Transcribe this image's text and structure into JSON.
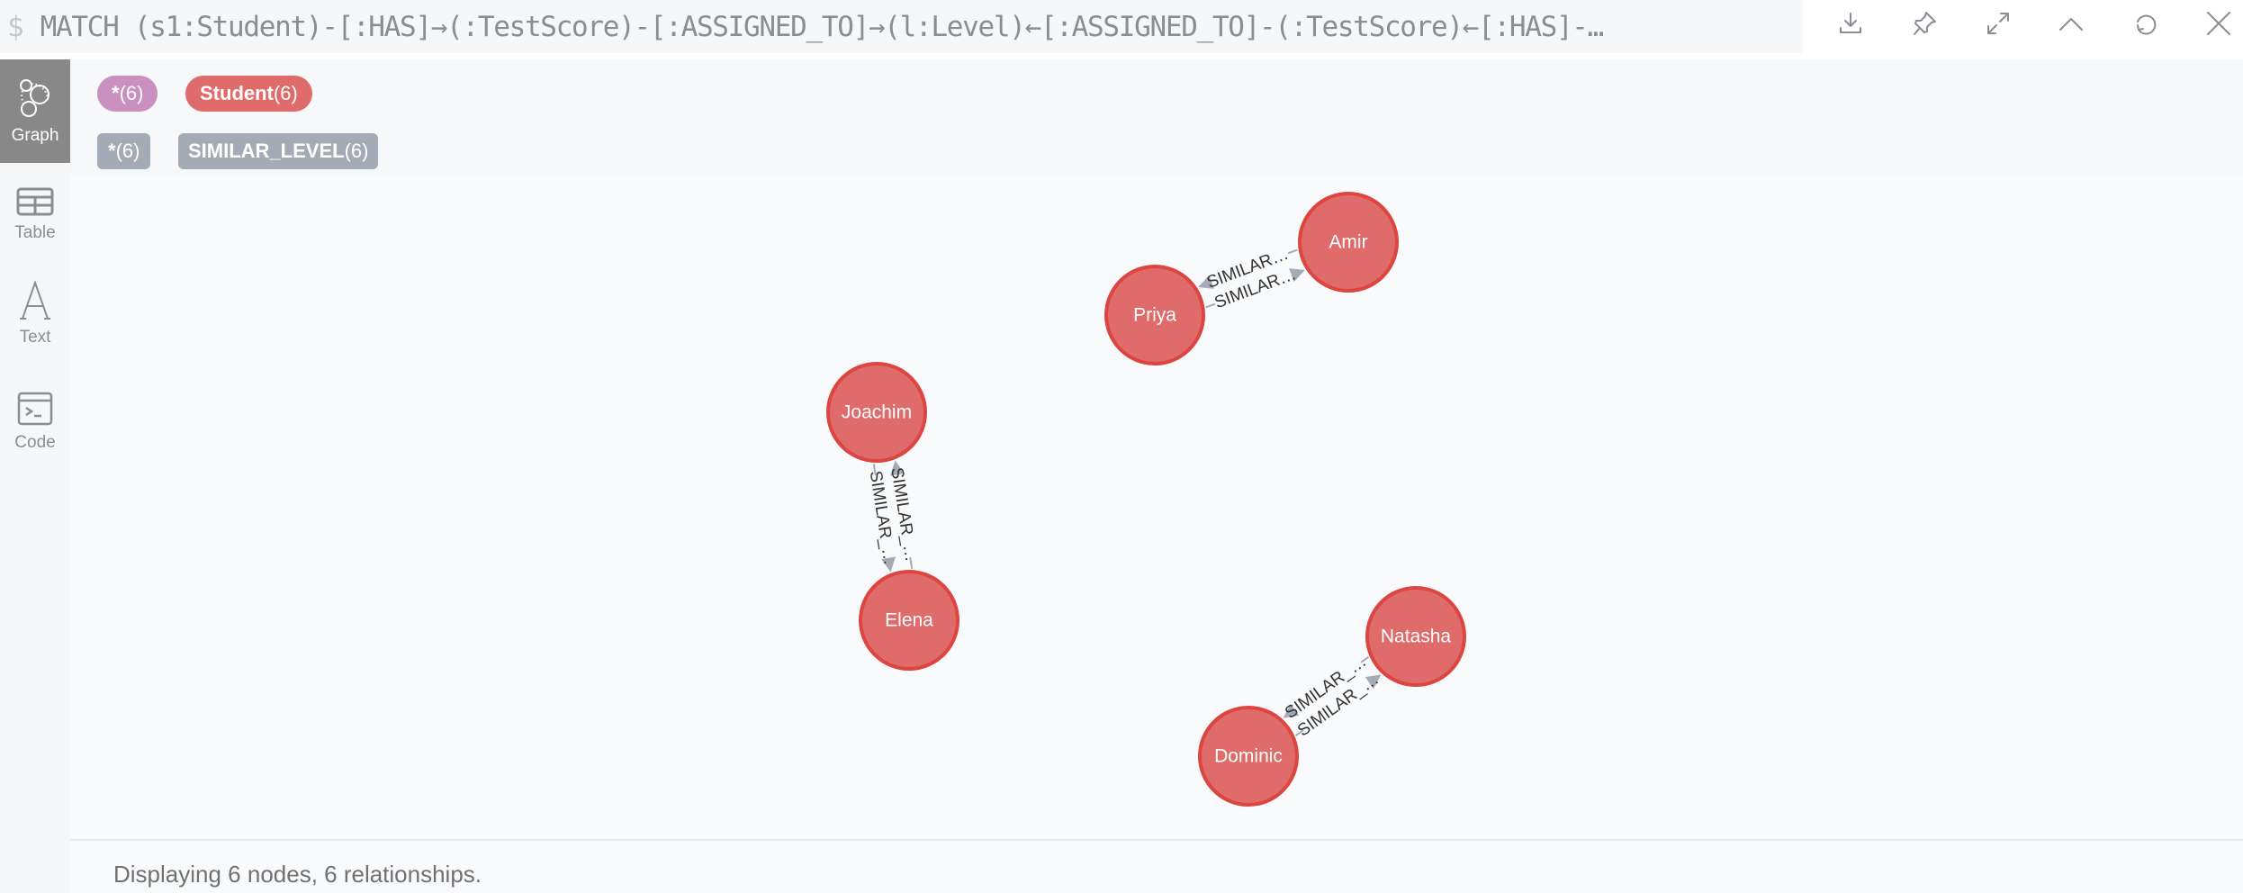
{
  "query_bar": {
    "prompt": "$",
    "query": "MATCH (s1:Student)-[:HAS]→(:TestScore)-[:ASSIGNED_TO]→(l:Level)←[:ASSIGNED_TO]-(:TestScore)←[:HAS]-…"
  },
  "frame_actions": [
    {
      "name": "download-icon",
      "label": "Export"
    },
    {
      "name": "pin-icon",
      "label": "Pin"
    },
    {
      "name": "expand-icon",
      "label": "Fullscreen"
    },
    {
      "name": "chevron-up-icon",
      "label": "Collapse"
    },
    {
      "name": "refresh-icon",
      "label": "Rerun"
    },
    {
      "name": "close-icon",
      "label": "Close"
    }
  ],
  "sidebar": {
    "items": [
      {
        "id": "graph",
        "label": "Graph",
        "active": true
      },
      {
        "id": "table",
        "label": "Table",
        "active": false
      },
      {
        "id": "text",
        "label": "Text",
        "active": false
      },
      {
        "id": "code",
        "label": "Code",
        "active": false
      }
    ]
  },
  "legend": {
    "node_labels": [
      {
        "name": "*",
        "count": "(6)",
        "color": "#C990C0"
      },
      {
        "name": "Student",
        "count": "(6)",
        "color": "#E06B6B"
      }
    ],
    "relationship_types": [
      {
        "name": "*",
        "count": "(6)",
        "color": "#A5ABB6"
      },
      {
        "name": "SIMILAR_LEVEL",
        "count": "(6)",
        "color": "#A5ABB6"
      }
    ]
  },
  "graph": {
    "node_color": "#E06B6B",
    "node_stroke": "#DC4540",
    "edge_color": "#A5ABB6",
    "nodes": [
      {
        "id": "amir",
        "label": "Amir"
      },
      {
        "id": "priya",
        "label": "Priya"
      },
      {
        "id": "joachim",
        "label": "Joachim"
      },
      {
        "id": "elena",
        "label": "Elena"
      },
      {
        "id": "natasha",
        "label": "Natasha"
      },
      {
        "id": "dominic",
        "label": "Dominic"
      }
    ],
    "relationships": [
      {
        "source": "amir",
        "target": "priya",
        "type": "SIMILAR_LEVEL",
        "caption": "SIMILAR…"
      },
      {
        "source": "priya",
        "target": "amir",
        "type": "SIMILAR_LEVEL",
        "caption": "SIMILAR…"
      },
      {
        "source": "joachim",
        "target": "elena",
        "type": "SIMILAR_LEVEL",
        "caption": "SIMILAR_…"
      },
      {
        "source": "elena",
        "target": "joachim",
        "type": "SIMILAR_LEVEL",
        "caption": "SIMILAR_…"
      },
      {
        "source": "dominic",
        "target": "natasha",
        "type": "SIMILAR_LEVEL",
        "caption": "SIMILAR_…"
      },
      {
        "source": "natasha",
        "target": "dominic",
        "type": "SIMILAR_LEVEL",
        "caption": "SIMILAR_…"
      }
    ]
  },
  "status": {
    "text": "Displaying 6 nodes, 6 relationships."
  }
}
